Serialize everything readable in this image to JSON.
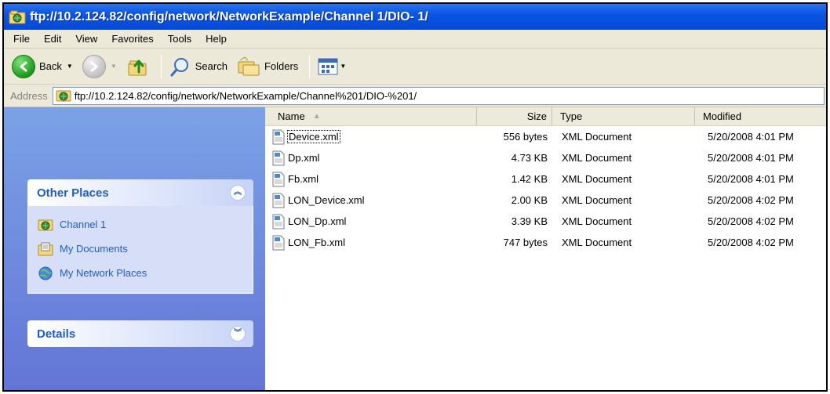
{
  "window": {
    "title": "ftp://10.2.124.82/config/network/NetworkExample/Channel 1/DIO- 1/"
  },
  "menu": [
    "File",
    "Edit",
    "View",
    "Favorites",
    "Tools",
    "Help"
  ],
  "toolbar": {
    "back_label": "Back",
    "search_label": "Search",
    "folders_label": "Folders"
  },
  "address": {
    "label": "Address",
    "value": "ftp://10.2.124.82/config/network/NetworkExample/Channel%201/DIO-%201/"
  },
  "sidebar": {
    "other_places": {
      "title": "Other Places",
      "items": [
        {
          "label": "Channel 1",
          "icon": "ftp-folder-icon"
        },
        {
          "label": "My Documents",
          "icon": "my-documents-icon"
        },
        {
          "label": "My Network Places",
          "icon": "network-places-icon"
        }
      ]
    },
    "details": {
      "title": "Details"
    }
  },
  "columns": {
    "name": "Name",
    "size": "Size",
    "type": "Type",
    "modified": "Modified"
  },
  "files": [
    {
      "name": "Device.xml",
      "size": "556 bytes",
      "type": "XML Document",
      "modified": "5/20/2008 4:01 PM"
    },
    {
      "name": "Dp.xml",
      "size": "4.73 KB",
      "type": "XML Document",
      "modified": "5/20/2008 4:01 PM"
    },
    {
      "name": "Fb.xml",
      "size": "1.42 KB",
      "type": "XML Document",
      "modified": "5/20/2008 4:01 PM"
    },
    {
      "name": "LON_Device.xml",
      "size": "2.00 KB",
      "type": "XML Document",
      "modified": "5/20/2008 4:02 PM"
    },
    {
      "name": "LON_Dp.xml",
      "size": "3.39 KB",
      "type": "XML Document",
      "modified": "5/20/2008 4:02 PM"
    },
    {
      "name": "LON_Fb.xml",
      "size": "747 bytes",
      "type": "XML Document",
      "modified": "5/20/2008 4:02 PM"
    }
  ],
  "colors": {
    "titlebar": "#0a55e2",
    "sidebar": "#7ba2e7",
    "link": "#215dc6"
  }
}
